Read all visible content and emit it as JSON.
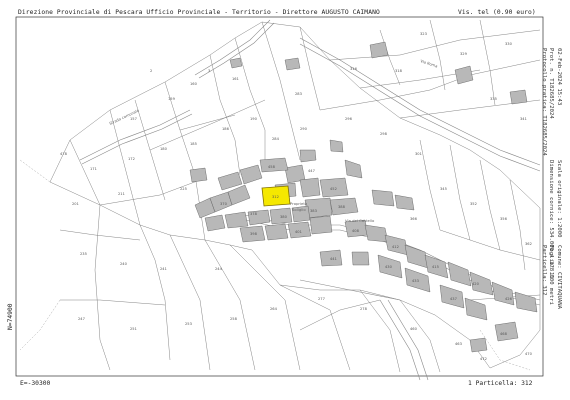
{
  "header": {
    "title": "Direzione Provinciale di Pescara  Ufficio Provinciale - Territorio - Direttore AUGUSTO CAIMANO",
    "visura": "Vis. tel (0.90 euro)"
  },
  "footer": {
    "east_coord": "E=-30300",
    "parcel_label": "1 Particella: 312"
  },
  "left_margin": {
    "north_coord": "N=74900"
  },
  "right_margin": {
    "lines": [
      "02-Feb-2024 15:43",
      "Prot. n. T182685/2024",
      "Protocollo pratica: T182685/2024",
      "Scala originale: 1:2000",
      "Dimensione cornice: 534.000 x 378.000 metri",
      "Comune: CIVITAQUANA",
      "Foglio: 11",
      "Particella: 312"
    ]
  },
  "map": {
    "highlight_color": "#f5e800",
    "highlighted_parcel": "312",
    "labels": {
      "prop_a": "Proprietà",
      "prop_b": "Soliglio",
      "street_a": "Strada comunale",
      "street_b": "Via del Castello",
      "street_c": "Via Roma"
    },
    "parcels": [
      "2",
      "3",
      "157",
      "159",
      "160",
      "161",
      "171",
      "172",
      "180",
      "185",
      "186",
      "190",
      "201",
      "211",
      "225",
      "235",
      "240",
      "241",
      "244",
      "247",
      "251",
      "253",
      "258",
      "264",
      "277",
      "278",
      "283",
      "284",
      "290",
      "296",
      "298",
      "301",
      "312",
      "316",
      "318",
      "323",
      "329",
      "330",
      "335",
      "341",
      "345",
      "352",
      "356",
      "362",
      "366",
      "370",
      "378",
      "380",
      "383",
      "388",
      "398",
      "401",
      "408",
      "412",
      "415",
      "420",
      "426",
      "430",
      "433",
      "437",
      "441",
      "447",
      "452",
      "458",
      "460",
      "463",
      "468",
      "470",
      "472",
      "478"
    ]
  }
}
